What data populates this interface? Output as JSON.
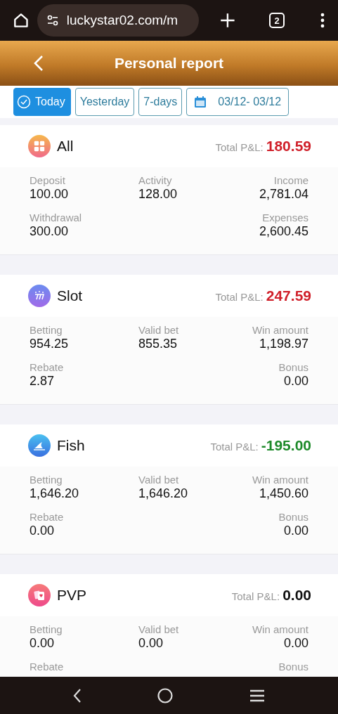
{
  "browser": {
    "url": "luckystar02.com/m",
    "tab_count": "2"
  },
  "header": {
    "title": "Personal report"
  },
  "filters": [
    {
      "kind": "preset",
      "label": "Today",
      "selected": true
    },
    {
      "kind": "preset",
      "label": "Yesterday",
      "selected": false
    },
    {
      "kind": "preset",
      "label": "7-days",
      "selected": false
    },
    {
      "kind": "date",
      "label": "03/12- 03/12",
      "selected": false
    }
  ],
  "categories": [
    {
      "name": "All",
      "pnl_label": "Total P&L:",
      "pnl": "180.59",
      "color": "#d0202a",
      "stats": [
        {
          "label": "Deposit",
          "value": "100.00"
        },
        {
          "label": "Activity",
          "value": "128.00"
        },
        {
          "label": "Income",
          "value": "2,781.04"
        },
        {
          "label": "Withdrawal",
          "value": "300.00"
        },
        {
          "label": "Expenses",
          "value": "2,600.45"
        }
      ]
    },
    {
      "name": "Slot",
      "pnl_label": "Total P&L:",
      "pnl": "247.59",
      "color": "#d0202a",
      "stats": [
        {
          "label": "Betting",
          "value": "954.25"
        },
        {
          "label": "Valid bet",
          "value": "855.35"
        },
        {
          "label": "Win amount",
          "value": "1,198.97"
        },
        {
          "label": "Rebate",
          "value": "2.87"
        },
        {
          "label": "Bonus",
          "value": "0.00"
        }
      ]
    },
    {
      "name": "Fish",
      "pnl_label": "Total P&L:",
      "pnl": "-195.00",
      "color": "#1e8a2a",
      "stats": [
        {
          "label": "Betting",
          "value": "1,646.20"
        },
        {
          "label": "Valid bet",
          "value": "1,646.20"
        },
        {
          "label": "Win amount",
          "value": "1,450.60"
        },
        {
          "label": "Rebate",
          "value": "0.00"
        },
        {
          "label": "Bonus",
          "value": "0.00"
        }
      ]
    },
    {
      "name": "PVP",
      "pnl_label": "Total P&L:",
      "pnl": "0.00",
      "color": "#111111",
      "stats": [
        {
          "label": "Betting",
          "value": "0.00"
        },
        {
          "label": "Valid bet",
          "value": "0.00"
        },
        {
          "label": "Win amount",
          "value": "0.00"
        },
        {
          "label": "Rebate"
        },
        {
          "label": "Bonus"
        }
      ]
    }
  ]
}
